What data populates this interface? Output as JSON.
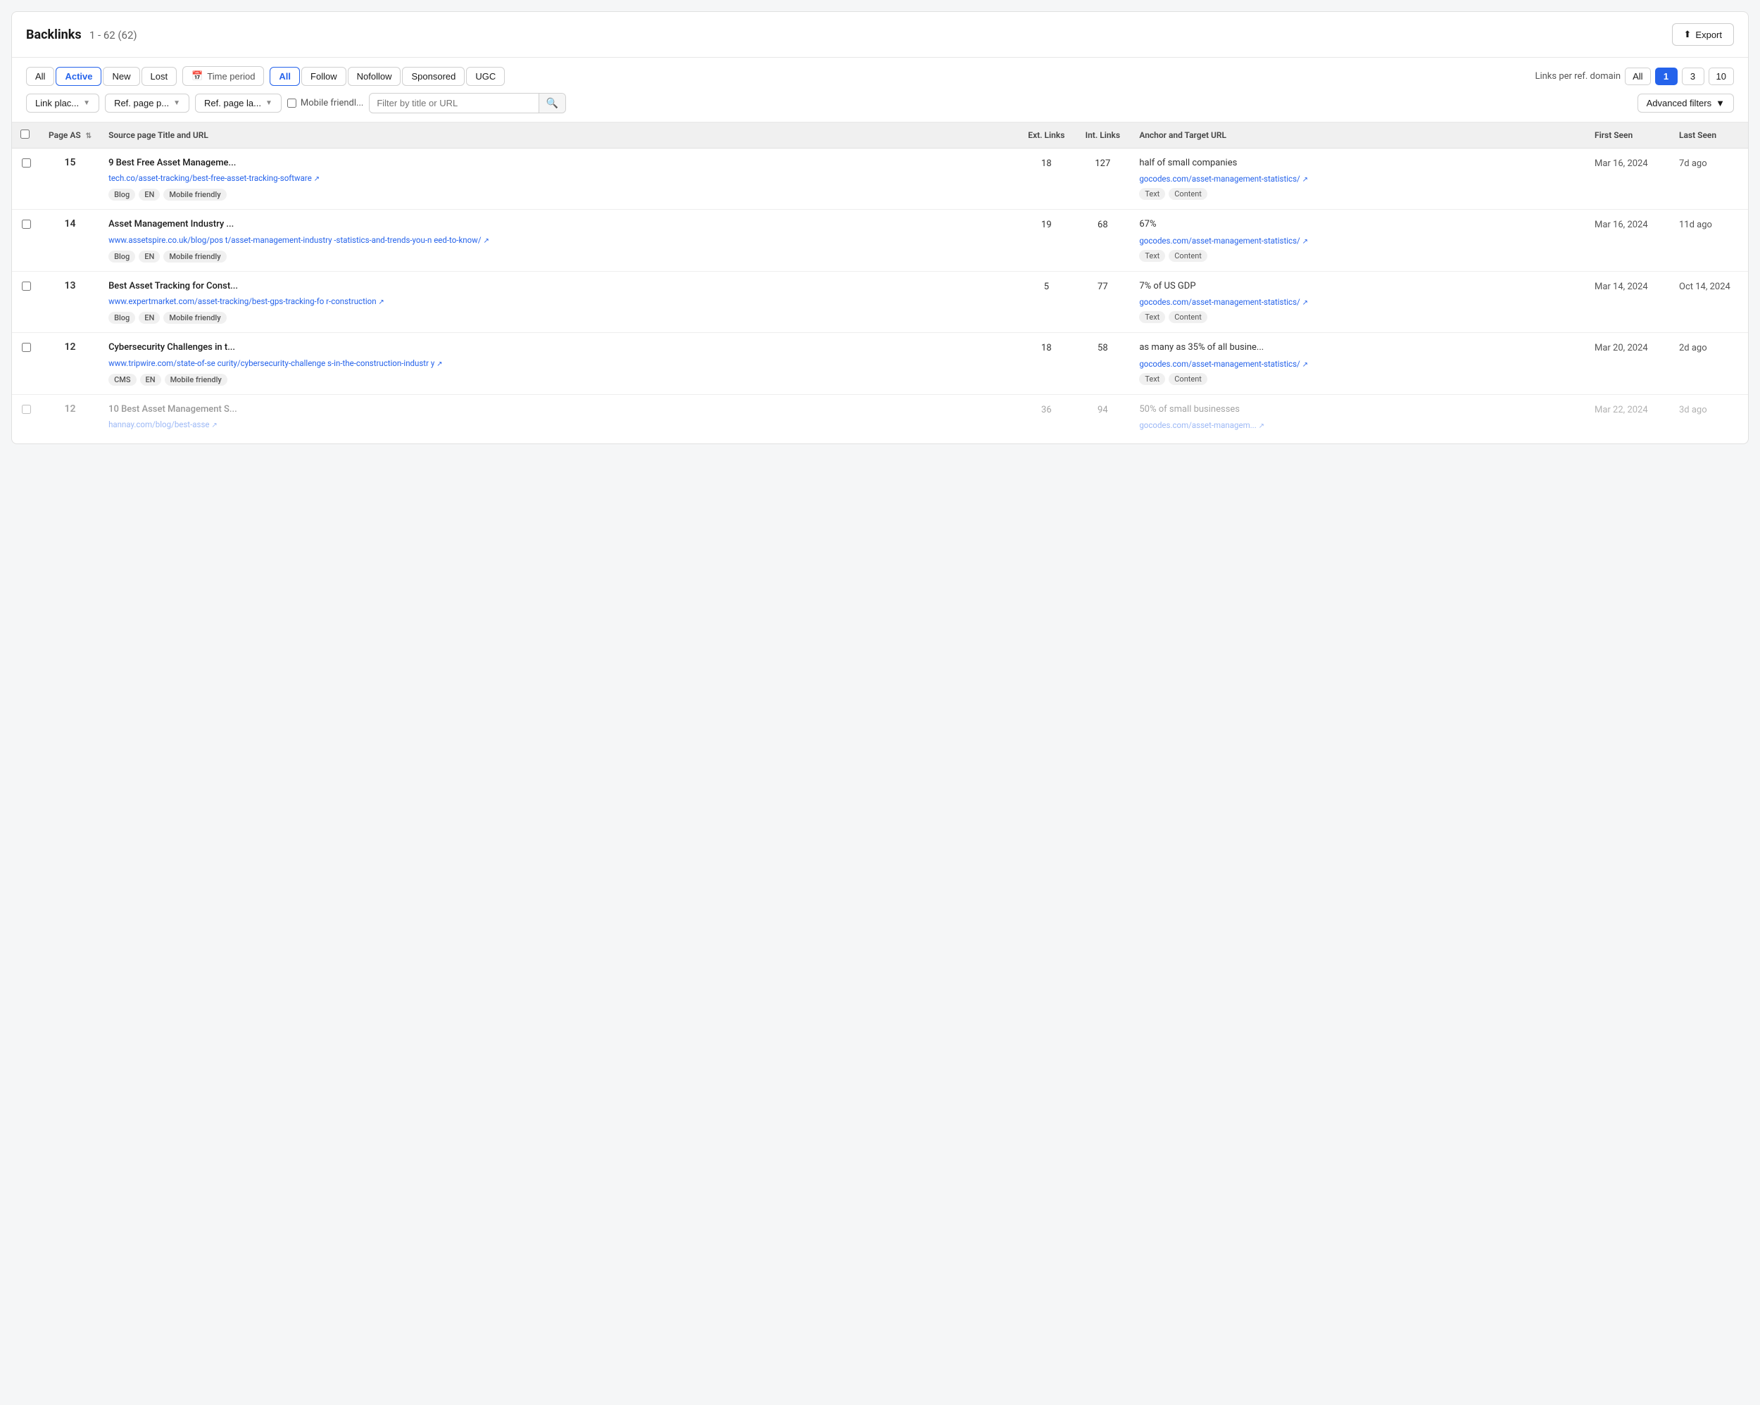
{
  "header": {
    "title": "Backlinks",
    "count": "1 - 62 (62)",
    "export_label": "Export"
  },
  "toolbar": {
    "status_filters": [
      {
        "label": "All",
        "active": false
      },
      {
        "label": "Active",
        "active": true
      },
      {
        "label": "New",
        "active": false
      },
      {
        "label": "Lost",
        "active": false
      }
    ],
    "time_period_label": "Time period",
    "link_type_filters": [
      {
        "label": "All",
        "active": true
      },
      {
        "label": "Follow",
        "active": false
      },
      {
        "label": "Nofollow",
        "active": false
      },
      {
        "label": "Sponsored",
        "active": false
      },
      {
        "label": "UGC",
        "active": false
      }
    ],
    "links_per_domain_label": "Links per ref. domain",
    "links_per_domain_options": [
      {
        "label": "All",
        "active": false
      },
      {
        "label": "1",
        "active": true
      },
      {
        "label": "3",
        "active": false
      },
      {
        "label": "10",
        "active": false
      }
    ],
    "link_placement_label": "Link plac...",
    "ref_page_prop_label": "Ref. page p...",
    "ref_page_lang_label": "Ref. page la...",
    "mobile_friendly_label": "Mobile friendl...",
    "search_placeholder": "Filter by title or URL",
    "advanced_filters_label": "Advanced filters"
  },
  "table": {
    "columns": [
      "",
      "Page AS",
      "Source page Title and URL",
      "Ext. Links",
      "Int. Links",
      "Anchor and Target URL",
      "First Seen",
      "Last Seen"
    ],
    "rows": [
      {
        "page_as": "15",
        "source_title": "9 Best Free Asset Manageme...",
        "source_url": "tech.co/asset-tracking/best-fr ee-asset-tracking-software",
        "source_url_display": "tech.co/asset-tracking/best-free-asset-tracking-software",
        "ext_links": "18",
        "int_links": "127",
        "anchor_text": "half of small companies",
        "anchor_url": "gocodes.com/asset-management-statistics/",
        "anchor_tags": [
          "Text",
          "Content"
        ],
        "tags": [
          "Blog",
          "EN",
          "Mobile friendly"
        ],
        "first_seen": "Mar 16, 2024",
        "last_seen": "7d ago",
        "faded": false
      },
      {
        "page_as": "14",
        "source_title": "Asset Management Industry ...",
        "source_url": "www.assetspire.co.uk/blog/post/asset-management-industry-statistics-and-trends-you-need-to-know/",
        "source_url_display": "www.assetspire.co.uk/blog/pos t/asset-management-industry -statistics-and-trends-you-n eed-to-know/",
        "ext_links": "19",
        "int_links": "68",
        "anchor_text": "67%",
        "anchor_url": "gocodes.com/asset-management-statistics/",
        "anchor_tags": [
          "Text",
          "Content"
        ],
        "tags": [
          "Blog",
          "EN",
          "Mobile friendly"
        ],
        "first_seen": "Mar 16, 2024",
        "last_seen": "11d ago",
        "faded": false
      },
      {
        "page_as": "13",
        "source_title": "Best Asset Tracking for Const...",
        "source_url": "www.expertmarket.com/asset-tracking/best-gps-tracking-for-construction",
        "source_url_display": "www.expertmarket.com/asset-tracking/best-gps-tracking-fo r-construction",
        "ext_links": "5",
        "int_links": "77",
        "anchor_text": "7% of US GDP",
        "anchor_url": "gocodes.com/asset-management-statistics/",
        "anchor_tags": [
          "Text",
          "Content"
        ],
        "tags": [
          "Blog",
          "EN",
          "Mobile friendly"
        ],
        "first_seen": "Mar 14, 2024",
        "last_seen": "Oct 14, 2024",
        "faded": false
      },
      {
        "page_as": "12",
        "source_title": "Cybersecurity Challenges in t...",
        "source_url": "www.tripwire.com/state-of-security/cybersecurity-challenges-in-the-construction-industry",
        "source_url_display": "www.tripwire.com/state-of-se curity/cybersecurity-challenge s-in-the-construction-industr y",
        "ext_links": "18",
        "int_links": "58",
        "anchor_text": "as many as 35% of all busine...",
        "anchor_url": "gocodes.com/asset-management-statistics/",
        "anchor_tags": [
          "Text",
          "Content"
        ],
        "tags": [
          "CMS",
          "EN",
          "Mobile friendly"
        ],
        "first_seen": "Mar 20, 2024",
        "last_seen": "2d ago",
        "faded": false
      },
      {
        "page_as": "12",
        "source_title": "10 Best Asset Management S...",
        "source_url": "hannay.com/blog/best-asse...",
        "source_url_display": "hannay.com/blog/best-asse",
        "ext_links": "36",
        "int_links": "94",
        "anchor_text": "50% of small businesses",
        "anchor_url": "gocodes.com/asset-managem...",
        "anchor_tags": [],
        "tags": [],
        "first_seen": "Mar 22, 2024",
        "last_seen": "3d ago",
        "faded": true
      }
    ]
  }
}
